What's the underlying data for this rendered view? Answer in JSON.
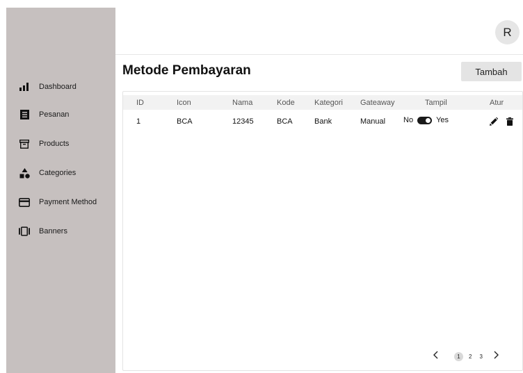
{
  "sidebar": {
    "items": [
      {
        "label": "Dashboard",
        "icon": "bar-chart-icon"
      },
      {
        "label": "Pesanan",
        "icon": "document-icon"
      },
      {
        "label": "Products",
        "icon": "archive-box-icon"
      },
      {
        "label": "Categories",
        "icon": "shapes-icon"
      },
      {
        "label": "Payment Method",
        "icon": "credit-card-icon"
      },
      {
        "label": "Banners",
        "icon": "carousel-icon"
      }
    ]
  },
  "header": {
    "avatar_initial": "R"
  },
  "main": {
    "title": "Metode Pembayaran",
    "add_button_label": "Tambah",
    "table": {
      "columns": [
        "ID",
        "Icon",
        "Nama",
        "Kode",
        "Kategori",
        "Gateaway",
        "Tampil",
        "Atur"
      ],
      "rows": [
        {
          "id": "1",
          "icon": "BCA",
          "nama": "12345",
          "kode": "BCA",
          "kategori": "Bank",
          "gateaway": "Manual",
          "tampil": {
            "off_label": "No",
            "on_label": "Yes",
            "value": true
          }
        }
      ]
    },
    "pagination": {
      "pages": [
        "1",
        "2",
        "3"
      ],
      "current": "1"
    }
  }
}
